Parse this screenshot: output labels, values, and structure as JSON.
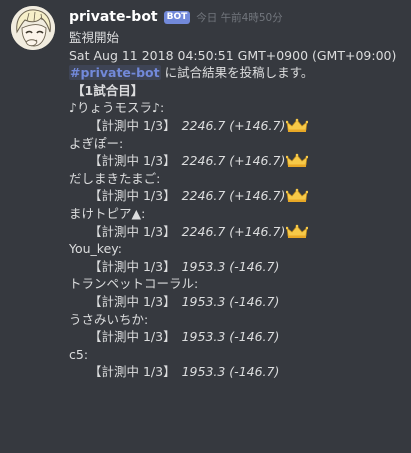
{
  "message": {
    "username": "private-bot",
    "bot_tag": "BOT",
    "timestamp": "今日 午前4時50分",
    "avatar_icon": "anime-character-avatar",
    "lines": {
      "monitor_start": "監視開始",
      "datetime": "Sat Aug 11 2018 04:50:51 GMT+0900 (GMT+09:00)",
      "channel_mention": "#private-bot",
      "post_suffix": " に試合結果を投稿します。",
      "match_header": "【1試合目】"
    },
    "players": [
      {
        "name": "♪りょうモスラ♪:",
        "status": "【計測中 1/3】",
        "score": "2246.7 (+146.7)",
        "crown": true
      },
      {
        "name": "よぎぽー:",
        "status": "【計測中 1/3】",
        "score": "2246.7 (+146.7)",
        "crown": true
      },
      {
        "name": "だしまきたまご:",
        "status": "【計測中 1/3】",
        "score": "2246.7 (+146.7)",
        "crown": true
      },
      {
        "name": "まけトピア▲:",
        "status": "【計測中 1/3】",
        "score": "2246.7 (+146.7)",
        "crown": true
      },
      {
        "name": "You_key:",
        "status": "【計測中 1/3】",
        "score": "1953.3 (-146.7)",
        "crown": false
      },
      {
        "name": "トランペットコーラル:",
        "status": "【計測中 1/3】",
        "score": "1953.3 (-146.7)",
        "crown": false
      },
      {
        "name": "うさみいちか:",
        "status": "【計測中 1/3】",
        "score": "1953.3 (-146.7)",
        "crown": false
      },
      {
        "name": "c5:",
        "status": "【計測中 1/3】",
        "score": "1953.3 (-146.7)",
        "crown": false
      }
    ],
    "crown_icon": "crown-icon"
  },
  "colors": {
    "background": "#36393f",
    "username": "#ffffff",
    "text": "#dcddde",
    "timestamp": "#72767d",
    "bot_tag": "#7289da",
    "mention": "#7289da",
    "crown": "#f7c948"
  }
}
